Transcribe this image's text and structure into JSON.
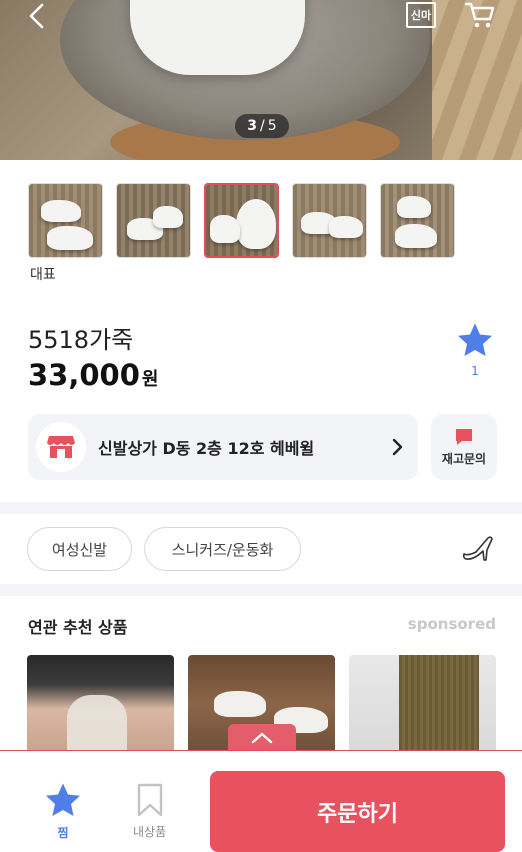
{
  "hero": {
    "page_current": "3",
    "page_separator": "/",
    "page_total": "5",
    "sinma_label": "신마"
  },
  "thumbnails": {
    "main_label": "대표",
    "count": 5,
    "selected_index": 2
  },
  "product": {
    "name": "5518가죽",
    "price": "33,000",
    "price_unit": "원",
    "favorite_count": "1"
  },
  "store": {
    "name": "신발상가 D동 2층 12호 헤베윌",
    "stock_inquiry_label": "재고문의"
  },
  "tags": [
    "여성신발",
    "스니커즈/운동화"
  ],
  "related": {
    "title": "연관 추천 상품",
    "sponsored_label": "sponsored"
  },
  "bottom_bar": {
    "wishlist_label": "찜",
    "my_products_label": "내상품",
    "order_label": "주문하기"
  },
  "colors": {
    "accent": "#e8525f",
    "star_blue": "#4f7ee8"
  }
}
